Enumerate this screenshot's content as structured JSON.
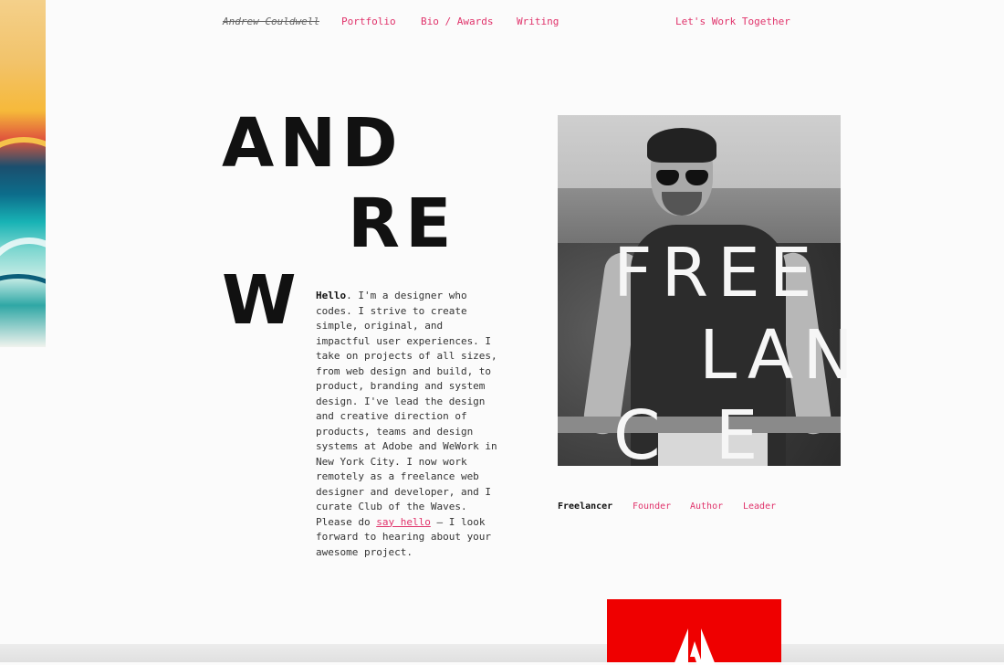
{
  "nav": {
    "brand": "Andrew Couldwell",
    "items": [
      "Portfolio",
      "Bio / Awards",
      "Writing"
    ],
    "cta": "Let's Work Together"
  },
  "hero": {
    "letters": [
      "AND",
      "RE",
      "W"
    ],
    "intro": {
      "lead": "Hello",
      "text_1": ". I'm a designer who codes. I strive to create simple, original, and impactful user experiences. I take on projects of all sizes, from web design and build, to product, branding and system design. I've lead the design and creative direction of products, teams and design systems at Adobe and WeWork in New York City. I now work remotely as a freelance web designer and developer, and I curate Club of the Waves. Please do ",
      "link": "say hello",
      "text_2": " — I look forward to hearing about your awesome project."
    }
  },
  "photo": {
    "overlay": [
      "FREE",
      "LAN",
      "CE"
    ]
  },
  "roles": {
    "active": "Freelancer",
    "items": [
      "Founder",
      "Author",
      "Leader"
    ]
  },
  "colors": {
    "accent": "#e0336b",
    "adobe_red": "#ef0000"
  },
  "icons": {
    "adobe": "adobe-logo-icon"
  }
}
